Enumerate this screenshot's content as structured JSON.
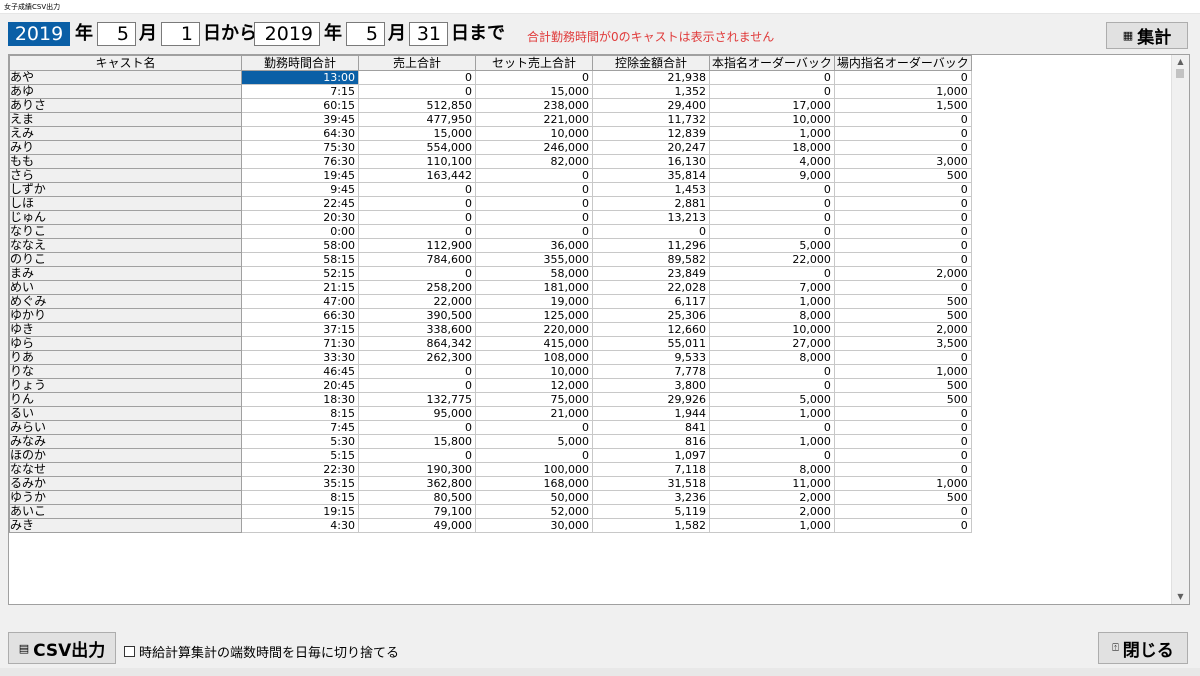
{
  "window": {
    "title": "女子成績CSV出力"
  },
  "filters": {
    "from_year": "2019",
    "year_label": "年",
    "from_month": "5",
    "month_label": "月",
    "from_day": "1",
    "from_label": "日から",
    "to_year": "2019",
    "to_month": "5",
    "to_day": "31",
    "to_label": "日まで",
    "notice": "合計勤務時間が0のキャストは表示されません"
  },
  "buttons": {
    "aggregate": "集計",
    "csv": "CSV出力",
    "close": "閉じる"
  },
  "options": {
    "truncate_label": "時給計算集計の端数時間を日毎に切り捨てる"
  },
  "table": {
    "columns": [
      "キャスト名",
      "勤務時間合計",
      "売上合計",
      "セット売上合計",
      "控除金額合計",
      "本指名オーダーバック",
      "場内指名オーダーバック"
    ],
    "rows": [
      [
        "あや",
        "13:00",
        "0",
        "0",
        "21,938",
        "0",
        "0"
      ],
      [
        "あゆ",
        "7:15",
        "0",
        "15,000",
        "1,352",
        "0",
        "1,000"
      ],
      [
        "ありさ",
        "60:15",
        "512,850",
        "238,000",
        "29,400",
        "17,000",
        "1,500"
      ],
      [
        "えま",
        "39:45",
        "477,950",
        "221,000",
        "11,732",
        "10,000",
        "0"
      ],
      [
        "えみ",
        "64:30",
        "15,000",
        "10,000",
        "12,839",
        "1,000",
        "0"
      ],
      [
        "みり",
        "75:30",
        "554,000",
        "246,000",
        "20,247",
        "18,000",
        "0"
      ],
      [
        "もも",
        "76:30",
        "110,100",
        "82,000",
        "16,130",
        "4,000",
        "3,000"
      ],
      [
        "さら",
        "19:45",
        "163,442",
        "0",
        "35,814",
        "9,000",
        "500"
      ],
      [
        "しずか",
        "9:45",
        "0",
        "0",
        "1,453",
        "0",
        "0"
      ],
      [
        "しほ",
        "22:45",
        "0",
        "0",
        "2,881",
        "0",
        "0"
      ],
      [
        "じゅん",
        "20:30",
        "0",
        "0",
        "13,213",
        "0",
        "0"
      ],
      [
        "なりこ",
        "0:00",
        "0",
        "0",
        "0",
        "0",
        "0"
      ],
      [
        "ななえ",
        "58:00",
        "112,900",
        "36,000",
        "11,296",
        "5,000",
        "0"
      ],
      [
        "のりこ",
        "58:15",
        "784,600",
        "355,000",
        "89,582",
        "22,000",
        "0"
      ],
      [
        "まみ",
        "52:15",
        "0",
        "58,000",
        "23,849",
        "0",
        "2,000"
      ],
      [
        "めい",
        "21:15",
        "258,200",
        "181,000",
        "22,028",
        "7,000",
        "0"
      ],
      [
        "めぐみ",
        "47:00",
        "22,000",
        "19,000",
        "6,117",
        "1,000",
        "500"
      ],
      [
        "ゆかり",
        "66:30",
        "390,500",
        "125,000",
        "25,306",
        "8,000",
        "500"
      ],
      [
        "ゆき",
        "37:15",
        "338,600",
        "220,000",
        "12,660",
        "10,000",
        "2,000"
      ],
      [
        "ゆら",
        "71:30",
        "864,342",
        "415,000",
        "55,011",
        "27,000",
        "3,500"
      ],
      [
        "りあ",
        "33:30",
        "262,300",
        "108,000",
        "9,533",
        "8,000",
        "0"
      ],
      [
        "りな",
        "46:45",
        "0",
        "10,000",
        "7,778",
        "0",
        "1,000"
      ],
      [
        "りょう",
        "20:45",
        "0",
        "12,000",
        "3,800",
        "0",
        "500"
      ],
      [
        "りん",
        "18:30",
        "132,775",
        "75,000",
        "29,926",
        "5,000",
        "500"
      ],
      [
        "るい",
        "8:15",
        "95,000",
        "21,000",
        "1,944",
        "1,000",
        "0"
      ],
      [
        "みらい",
        "7:45",
        "0",
        "0",
        "841",
        "0",
        "0"
      ],
      [
        "みなみ",
        "5:30",
        "15,800",
        "5,000",
        "816",
        "1,000",
        "0"
      ],
      [
        "ほのか",
        "5:15",
        "0",
        "0",
        "1,097",
        "0",
        "0"
      ],
      [
        "ななせ",
        "22:30",
        "190,300",
        "100,000",
        "7,118",
        "8,000",
        "0"
      ],
      [
        "るみか",
        "35:15",
        "362,800",
        "168,000",
        "31,518",
        "11,000",
        "1,000"
      ],
      [
        "ゆうか",
        "8:15",
        "80,500",
        "50,000",
        "3,236",
        "2,000",
        "500"
      ],
      [
        "あいこ",
        "19:15",
        "79,100",
        "52,000",
        "5,119",
        "2,000",
        "0"
      ],
      [
        "みき",
        "4:30",
        "49,000",
        "30,000",
        "1,582",
        "1,000",
        "0"
      ]
    ]
  },
  "colors": {
    "selection": "#0a5fa6",
    "notice": "#e03a3a"
  },
  "icons": {
    "aggregate": "calculator-icon",
    "csv": "csv-file-icon",
    "close": "door-exit-icon"
  }
}
